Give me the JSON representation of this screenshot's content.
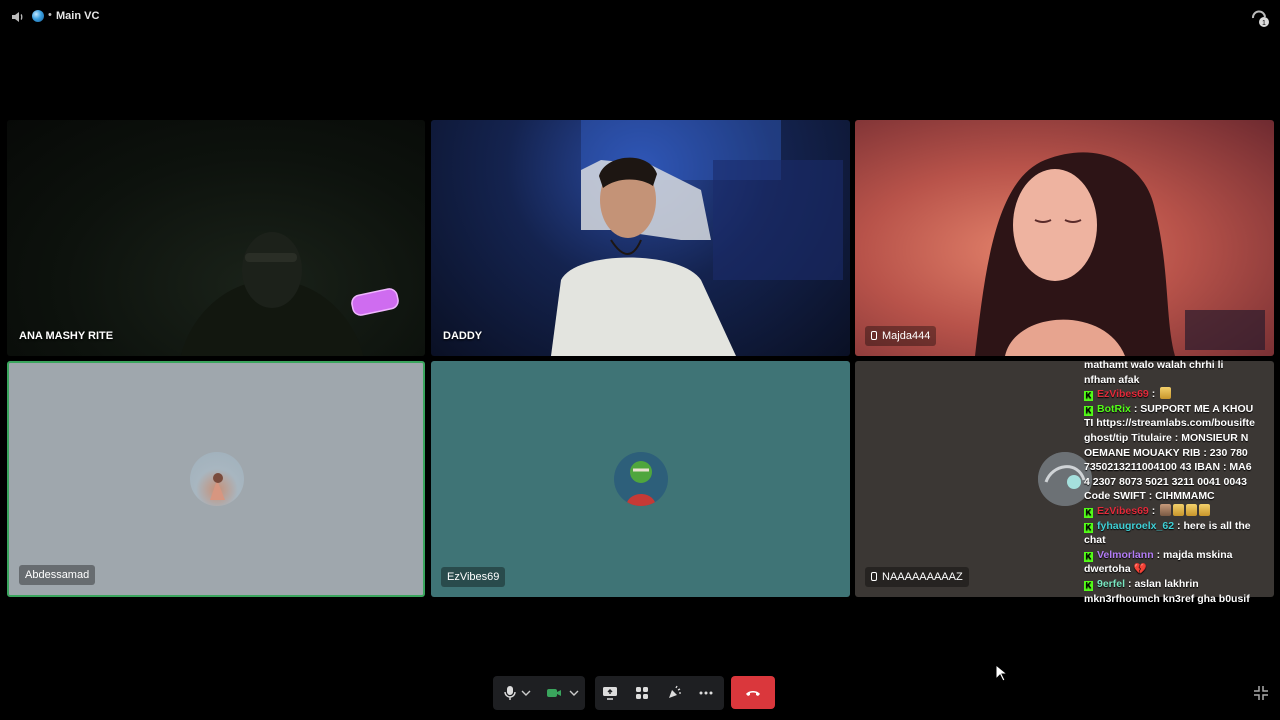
{
  "channel": {
    "name": "Main VC",
    "separator": "•"
  },
  "tiles": [
    {
      "name": "ANA MASHY RITE",
      "mobile": false
    },
    {
      "name": "DADDY",
      "mobile": false
    },
    {
      "name": "Majda444",
      "mobile": true
    },
    {
      "name": "Abdessamad",
      "mobile": false,
      "speaking": true
    },
    {
      "name": "EzVibes69",
      "mobile": false
    },
    {
      "name": "NAAAAAAAAAZ",
      "mobile": true
    }
  ],
  "chat_overlay": {
    "messages": [
      {
        "user": "",
        "text": "mathamt walo walah chrhi li nfham afak",
        "user_color": ""
      },
      {
        "user": "EzVibes69",
        "text": "",
        "user_color": "#e22a3a"
      },
      {
        "user": "BotRix",
        "text": "SUPPORT ME A KHOUTI https://streamlabs.com/bousifteghost/tip Titulaire : MONSIEUR NOEMANE MOUAKY RIB : 230 780 7350213211004100 43 IBAN : MA64 2307 8073 5021 3211 0041 0043 Code SWIFT : CIHMMAMC",
        "user_color": "#53fc18"
      },
      {
        "user": "EzVibes69",
        "text": "",
        "user_color": "#e22a3a"
      },
      {
        "user": "fyhaugroelx_62",
        "text": "here is all the chat",
        "user_color": "#3fd0d6"
      },
      {
        "user": "Velmorlann",
        "text": "majda mskina dwertoha 💔",
        "user_color": "#b27cf5"
      },
      {
        "user": "9erfel",
        "text": "aslan lakhrin mkn3rfhoumch kn3ref gha b0usif",
        "user_color": "#79e6c0"
      }
    ]
  },
  "controls": {
    "icons": [
      "microphone-icon",
      "chevron-down-icon",
      "camera-icon",
      "chevron-down-icon",
      "screen-share-icon",
      "activities-icon",
      "soundboard-icon",
      "more-icon",
      "end-call-icon"
    ],
    "end_call_color": "#da373c",
    "camera_on_color": "#3aa55d"
  },
  "colors": {
    "speaking_border": "#3aa55d"
  }
}
